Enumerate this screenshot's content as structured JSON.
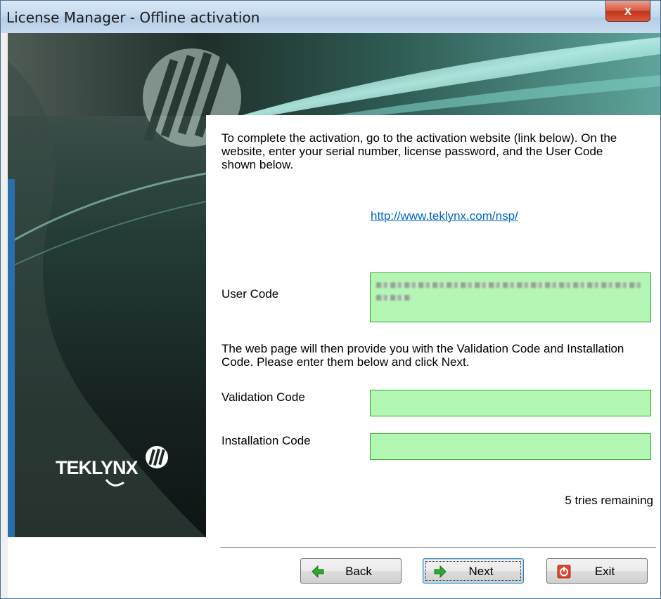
{
  "window": {
    "title": "License Manager - Offline activation",
    "close_glyph": "x"
  },
  "branding": {
    "logo_text": "TEKLYNX"
  },
  "instructions": {
    "paragraph1_line1": "To complete the activation, go to the activation website (link below). On the",
    "paragraph1_line2": "website, enter your serial number, license password, and the User Code",
    "paragraph1_line3": "shown below.",
    "link": "http://www.teklynx.com/nsp/",
    "paragraph2_line1": "The web page will then provide you with the Validation Code and Installation",
    "paragraph2_line2": "Code. Please enter them below and click Next."
  },
  "fields": {
    "user_code_label": "User Code",
    "validation_code_label": "Validation Code",
    "validation_code_value": "",
    "installation_code_label": "Installation Code",
    "installation_code_value": ""
  },
  "status": {
    "tries_remaining": "5 tries remaining"
  },
  "buttons": {
    "back": {
      "label": "Back",
      "icon": "arrow-left-icon"
    },
    "next": {
      "label": "Next",
      "icon": "arrow-right-icon"
    },
    "exit": {
      "label": "Exit",
      "icon": "power-icon"
    }
  },
  "colors": {
    "field_bg": "#b4f7b4",
    "field_border": "#2eaa2e",
    "link": "#0066cc",
    "close": "#c7432a"
  }
}
